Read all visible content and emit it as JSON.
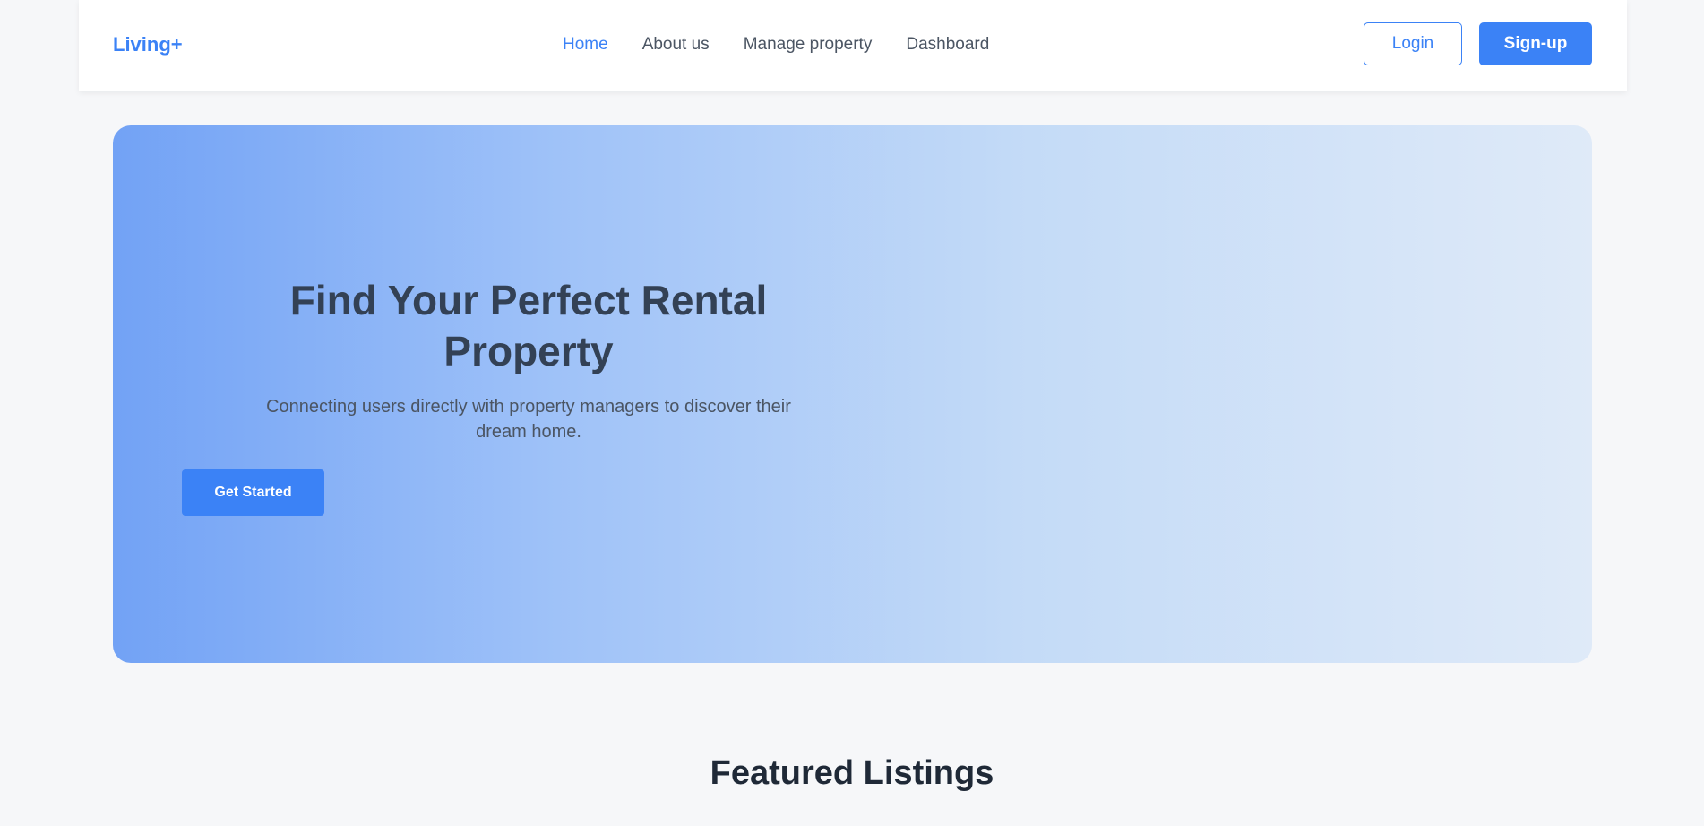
{
  "navbar": {
    "logo": "Living+",
    "links": [
      {
        "label": "Home",
        "active": true
      },
      {
        "label": "About us",
        "active": false
      },
      {
        "label": "Manage property",
        "active": false
      },
      {
        "label": "Dashboard",
        "active": false
      }
    ],
    "login_label": "Login",
    "signup_label": "Sign-up"
  },
  "hero": {
    "title": "Find Your Perfect Rental Property",
    "subtitle": "Connecting users directly with property managers to discover their dream home.",
    "cta_label": "Get Started"
  },
  "featured": {
    "title": "Featured Listings"
  },
  "colors": {
    "accent": "#3b82f6",
    "page_background": "#f6f7f9",
    "heading": "#334155"
  }
}
